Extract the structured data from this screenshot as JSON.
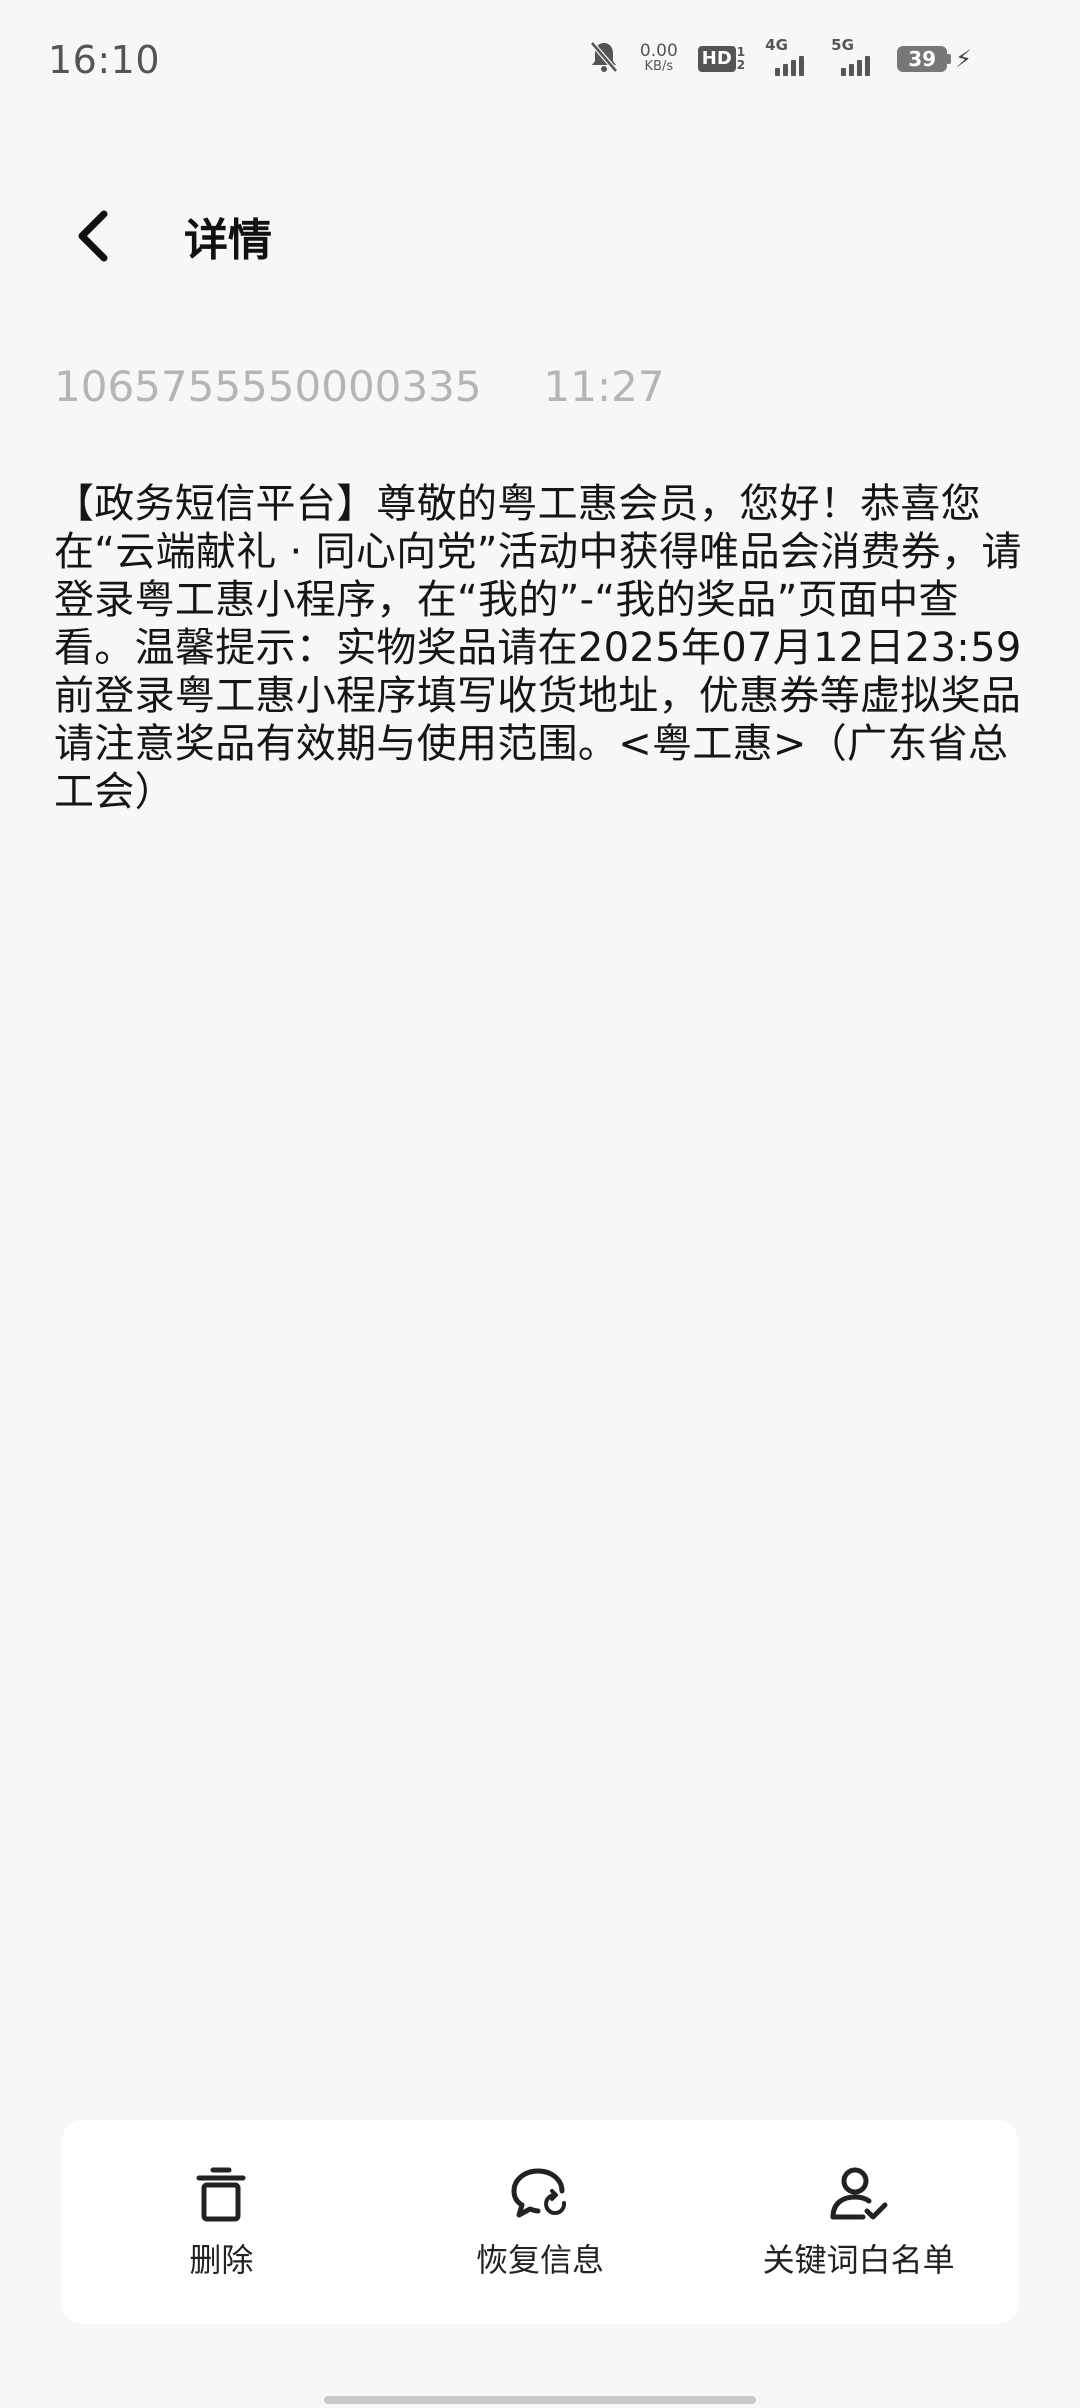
{
  "status_bar": {
    "time": "16:10",
    "net_speed_value": "0.00",
    "net_speed_unit": "KB/s",
    "hd_label": "HD",
    "hd_sub_top": "1",
    "hd_sub_bottom": "2",
    "signal_1_label": "4G",
    "signal_2_label": "5G",
    "battery_level": "39",
    "icons": [
      "mute-bell-icon",
      "hd-icon",
      "signal-4g-icon",
      "signal-5g-icon",
      "battery-icon",
      "charging-bolt-icon"
    ]
  },
  "header": {
    "title": "详情",
    "back_icon": "chevron-left-icon"
  },
  "message_meta": {
    "sender": "1065755550000335",
    "time": "11:27"
  },
  "message_body": "【政务短信平台】尊敬的粤工惠会员，您好！恭喜您在“云端献礼 · 同心向党”活动中获得唯品会消费券，请登录粤工惠小程序，在“我的”-“我的奖品”页面中查看。温馨提示：实物奖品请在2025年07月12日23:59 前登录粤工惠小程序填写收货地址，优惠券等虚拟奖品请注意奖品有效期与使用范围。<粤工惠>（广东省总工会）",
  "actions": [
    {
      "label": "删除",
      "icon": "trash-icon"
    },
    {
      "label": "恢复信息",
      "icon": "chat-restore-icon"
    },
    {
      "label": "关键词白名单",
      "icon": "user-check-icon"
    }
  ]
}
